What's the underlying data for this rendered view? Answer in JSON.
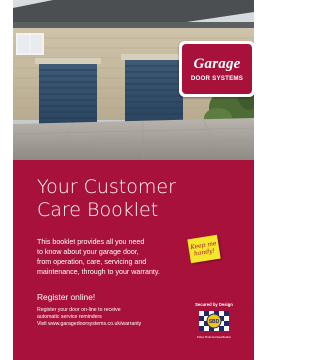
{
  "brand": {
    "logo_word": "Garage",
    "logo_sub": "DOOR SYSTEMS",
    "color": "#a8123a"
  },
  "title_lines": [
    "Your Customer",
    "Care Booklet"
  ],
  "intro_lines": [
    "This booklet provides all you need",
    "to know about your garage door,",
    "from operation, care, servicing and",
    "maintenance, through to your warranty."
  ],
  "sticky_note": {
    "lines": [
      "Keep me",
      "handy!"
    ],
    "color": "#f4e62a"
  },
  "register": {
    "heading": "Register online!",
    "lines": [
      "Register your door on-line to receive",
      "automatic service reminders",
      "Visit www.garagedoorsystems.co.uk/warranty"
    ]
  },
  "badge": {
    "label": "Secured by Design",
    "sub": "Police Preferred Specification",
    "center_text": "SBD"
  },
  "photo": {
    "icons": [
      "house-facade",
      "roller-garage-door-left",
      "roller-garage-door-right"
    ]
  }
}
